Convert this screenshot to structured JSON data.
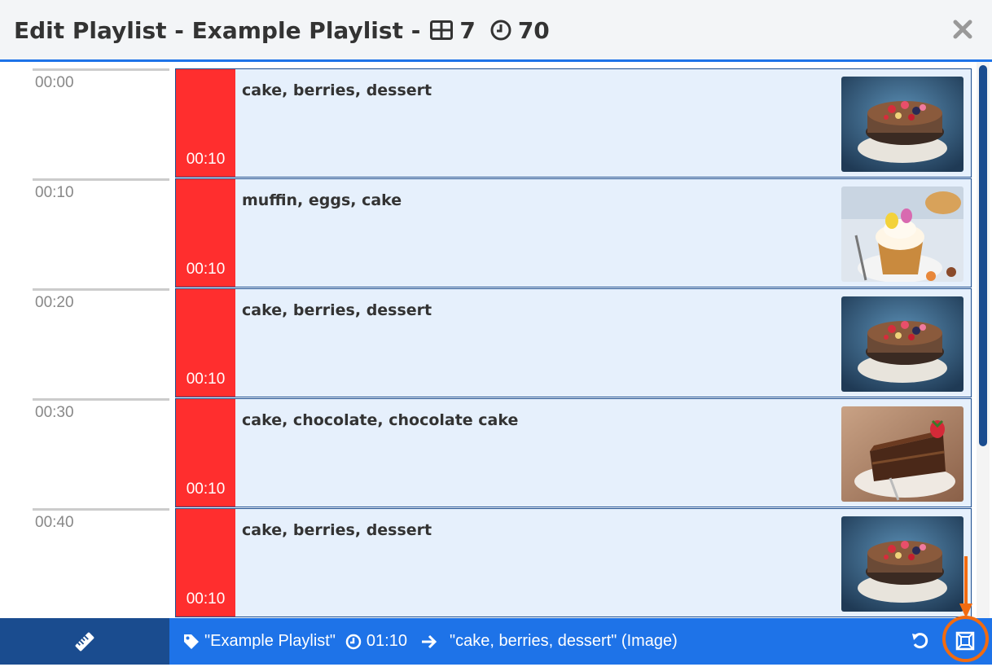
{
  "header": {
    "title": "Edit Playlist - Example Playlist -",
    "item_count": "7",
    "duration_total": "70",
    "icons": [
      "grid-icon",
      "clock-icon",
      "close-icon"
    ]
  },
  "timeline": {
    "ticks": [
      "00:00",
      "00:10",
      "00:20",
      "00:30",
      "00:40"
    ]
  },
  "items": [
    {
      "label": "cake, berries, dessert",
      "duration": "00:10",
      "image": "cake-berries-photo",
      "color": "#ff2e2e"
    },
    {
      "label": "muffin, eggs, cake",
      "duration": "00:10",
      "image": "muffin-eggs-photo",
      "color": "#ff2e2e"
    },
    {
      "label": "cake, berries, dessert",
      "duration": "00:10",
      "image": "cake-berries-photo",
      "color": "#ff2e2e"
    },
    {
      "label": "cake, chocolate, chocolate cake",
      "duration": "00:10",
      "image": "chocolate-cake-photo",
      "color": "#ff2e2e"
    },
    {
      "label": "cake, berries, dessert",
      "duration": "00:10",
      "image": "cake-berries-photo",
      "color": "#ff2e2e"
    }
  ],
  "footer": {
    "playlist_name": "\"Example Playlist\"",
    "duration": "01:10",
    "current_item": "\"cake, berries, dessert\" (Image)",
    "icons": [
      "ruler-icon",
      "tag-icon",
      "clock-icon",
      "arrow-right-icon",
      "undo-icon",
      "fullscreen-icon"
    ]
  },
  "colors": {
    "accent": "#1e73e8",
    "dark_blue": "#1a4c8f",
    "duration_red": "#ff2e2e",
    "item_bg": "#e6f0fc",
    "annotation_orange": "#f26b10"
  }
}
